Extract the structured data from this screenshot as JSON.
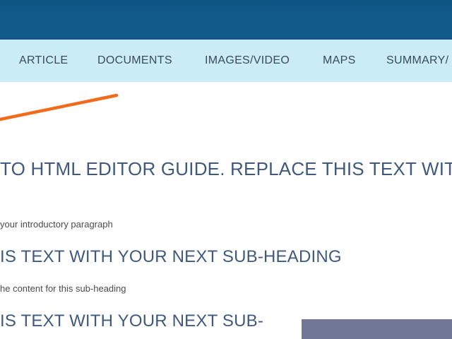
{
  "nav": {
    "items": [
      "ARTICLE",
      "DOCUMENTS",
      "IMAGES/VIDEO",
      "MAPS",
      "SUMMARY/"
    ]
  },
  "content": {
    "main_heading": "TO HTML EDITOR GUIDE. REPLACE THIS TEXT WITH MA",
    "intro_paragraph": "your introductory paragraph",
    "subheading_1": "IS TEXT WITH YOUR NEXT SUB-HEADING",
    "subheading_1_text": "he content for this sub-heading",
    "subheading_2": "IS TEXT WITH YOUR NEXT SUB-"
  },
  "colors": {
    "banner": "#115a8a",
    "nav_background": "#c9ecf5",
    "heading": "#3f5a7e",
    "annotation": "#f26b1d",
    "side_panel": "#717896"
  }
}
